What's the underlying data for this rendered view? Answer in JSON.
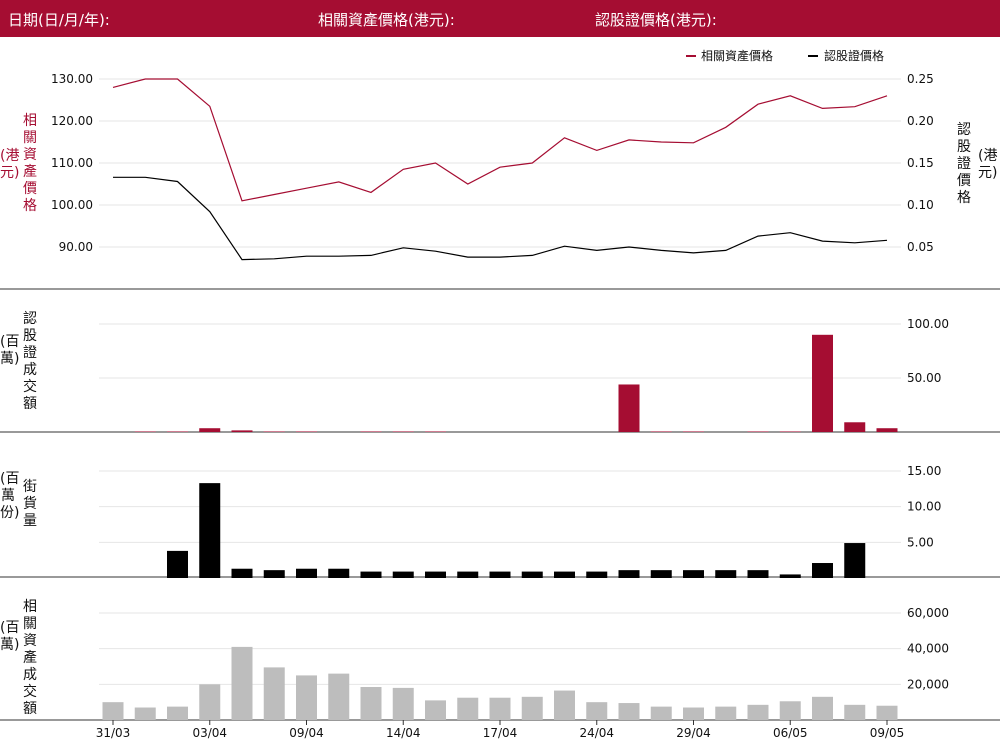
{
  "header": {
    "date_label": "日期(日/月/年):",
    "underlying_label": "相關資產價格(港元):",
    "warrant_label": "認股證價格(港元):"
  },
  "colors": {
    "header_bg": "#a50d32",
    "underlying": "#a50d32",
    "warrant": "#000000",
    "turnover_bar": "#a50d32",
    "outstanding_bar": "#000000",
    "underlying_turnover_bar": "#bdbdbd",
    "grid": "#e6e6e6"
  },
  "labels": {
    "price_left": "相關資產價格",
    "price_left_unit": "(港元)",
    "price_right": "認股證價格",
    "price_right_unit": "(港元)",
    "turnover": "認股證成交額",
    "turnover_unit": "(百萬)",
    "outstanding": "街貨量",
    "outstanding_unit": "(百萬份)",
    "underlying_turnover": "相關資產成交額",
    "underlying_turnover_unit": "(百萬)"
  },
  "chart_data": [
    {
      "type": "line",
      "legend": [
        "相關資產價格",
        "認股證價格"
      ],
      "legend_placement": "top-right",
      "x_tick_labels": [
        "31/03",
        "03/04",
        "09/04",
        "14/04",
        "17/04",
        "24/04",
        "29/04",
        "06/05",
        "09/05"
      ],
      "x_tick_indices": [
        0,
        3,
        6,
        9,
        12,
        15,
        18,
        21,
        24
      ],
      "series": [
        {
          "name": "相關資產價格",
          "axis": "left",
          "values": [
            128.0,
            130.0,
            130.0,
            123.5,
            101.0,
            102.5,
            104.0,
            105.5,
            103.0,
            108.5,
            110.0,
            105.0,
            109.0,
            110.0,
            116.0,
            113.0,
            115.5,
            115.0,
            114.8,
            118.5,
            124.0,
            126.0,
            123.0,
            123.4,
            126.0
          ]
        },
        {
          "name": "認股證價格",
          "axis": "right",
          "values": [
            0.133,
            0.133,
            0.128,
            0.092,
            0.035,
            0.036,
            0.039,
            0.039,
            0.04,
            0.049,
            0.045,
            0.038,
            0.038,
            0.04,
            0.051,
            0.046,
            0.05,
            0.046,
            0.043,
            0.046,
            0.063,
            0.067,
            0.057,
            0.055,
            0.058
          ]
        }
      ],
      "y_left": {
        "ticks": [
          90.0,
          100.0,
          110.0,
          120.0,
          130.0
        ],
        "tick_labels": [
          "90.00",
          "100.00",
          "110.00",
          "120.00",
          "130.00"
        ],
        "range": [
          83.0,
          132.5
        ]
      },
      "y_right": {
        "ticks": [
          0.05,
          0.1,
          0.15,
          0.2,
          0.25
        ],
        "tick_labels": [
          "0.05",
          "0.10",
          "0.15",
          "0.20",
          "0.25"
        ],
        "range": [
          0.01,
          0.26
        ]
      }
    },
    {
      "type": "bar",
      "name": "認股證成交額",
      "values": [
        0,
        0.5,
        0.5,
        3.5,
        1.5,
        0.5,
        0.5,
        0,
        0.5,
        0.5,
        0.5,
        0,
        0,
        0,
        0,
        0,
        44,
        0.5,
        0.5,
        0,
        0.5,
        0.5,
        90,
        9,
        3.5
      ],
      "ticks": [
        50,
        100
      ],
      "tick_labels": [
        "50.00",
        "100.00"
      ],
      "range": [
        0,
        124
      ]
    },
    {
      "type": "bar",
      "name": "街貨量",
      "values": [
        0,
        0,
        3.8,
        13.3,
        1.3,
        1.1,
        1.3,
        1.3,
        0.9,
        0.9,
        0.9,
        0.9,
        0.9,
        0.9,
        0.9,
        0.9,
        1.1,
        1.1,
        1.1,
        1.1,
        1.1,
        0.5,
        2.1,
        4.9,
        0
      ],
      "ticks": [
        5,
        10,
        15
      ],
      "tick_labels": [
        "5.00",
        "10.00",
        "15.00"
      ],
      "range": [
        0,
        16
      ]
    },
    {
      "type": "bar",
      "name": "相關資產成交額",
      "values": [
        10000,
        7000,
        7500,
        20000,
        41000,
        29500,
        25000,
        26000,
        18500,
        18000,
        11000,
        12500,
        12500,
        13000,
        16500,
        10000,
        9500,
        7500,
        7000,
        7500,
        8500,
        10500,
        13000,
        8500,
        8000
      ],
      "ticks": [
        20000,
        40000,
        60000
      ],
      "tick_labels": [
        "20,000",
        "40,000",
        "60,000"
      ],
      "range": [
        0,
        64000
      ]
    }
  ]
}
